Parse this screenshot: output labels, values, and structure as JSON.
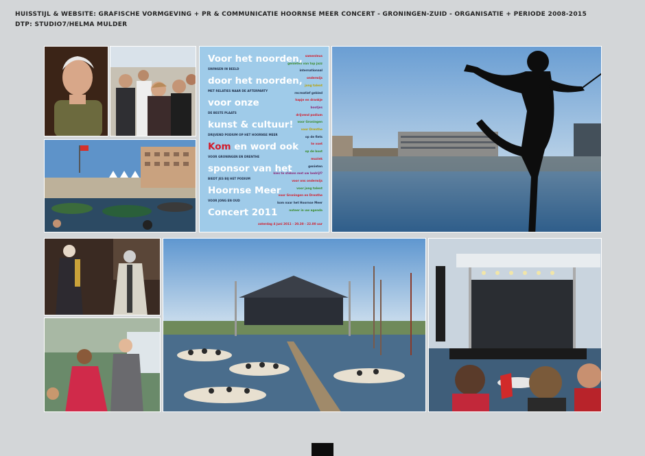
{
  "header": {
    "line1": "HUISSTIJL & WEBSITE: GRAFISCHE VORMGEVING + PR & COMMUNICATIE HOORNSE MEER CONCERT - GRONINGEN-ZUID - ORGANISATIE + PERIODE 2008-2015",
    "line2": "DTP: STUDIO7/HELMA MULDER"
  },
  "poster": {
    "big_lines": [
      "Voor het noorden,",
      "door het noorden,",
      "voor onze",
      "kunst & cultuur!",
      "Kom",
      "en word ook",
      "sponsor van het",
      "Hoornse Meer",
      "Concert 2011"
    ],
    "small_lines": [
      "SWINGEN IN BEELD",
      "MET RELATIES NAAR DE AFTERPARTY",
      "DE BESTE PLAATS",
      "DRIJVEND PODIUM OP HET HOORNSE MEER",
      "VOOR GRONINGEN EN DRENTHE",
      "BIEDT JES BIJ HET PODIUM",
      "VOOR JONG EN OUD"
    ],
    "right_words": [
      {
        "text": "samenleus",
        "color": "#d21c2b"
      },
      {
        "text": "genieten van top jazz",
        "color": "#3a8a2a"
      },
      {
        "text": "internationaal",
        "color": "#1e2e49"
      },
      {
        "text": "onderwijs",
        "color": "#d21c2b"
      },
      {
        "text": "jong talent",
        "color": "#b8a000"
      },
      {
        "text": "recreatief gebied",
        "color": "#1e2e49"
      },
      {
        "text": "hapje en drankje",
        "color": "#d21c2b"
      },
      {
        "text": "bootjes",
        "color": "#8b2a7a"
      },
      {
        "text": "drijvend podium",
        "color": "#d21c2b"
      },
      {
        "text": "voor Groningen",
        "color": "#3a8a2a"
      },
      {
        "text": "voor Drenthe",
        "color": "#b8a000"
      },
      {
        "text": "op de fiets",
        "color": "#1e2e49"
      },
      {
        "text": "te voet",
        "color": "#d21c2b"
      },
      {
        "text": "op de boot",
        "color": "#3a8a2a"
      },
      {
        "text": "muziek",
        "color": "#d21c2b"
      },
      {
        "text": "genieten",
        "color": "#1e2e49"
      },
      {
        "text": "kies te steken met uw bedrijf?",
        "color": "#8b2a7a"
      },
      {
        "text": "voor ons onderwijs",
        "color": "#d21c2b"
      },
      {
        "text": "voor jong talent",
        "color": "#3a8a2a"
      },
      {
        "text": "voor Groningen en Drenthe",
        "color": "#d21c2b"
      },
      {
        "text": "kom naar het Hoornse Meer",
        "color": "#1e2e49"
      },
      {
        "text": "noteer in uw agenda",
        "color": "#3a8a2a"
      }
    ],
    "date_line": "zaterdag 4 juni 2011 - 20.30 - 22.00 uur"
  }
}
